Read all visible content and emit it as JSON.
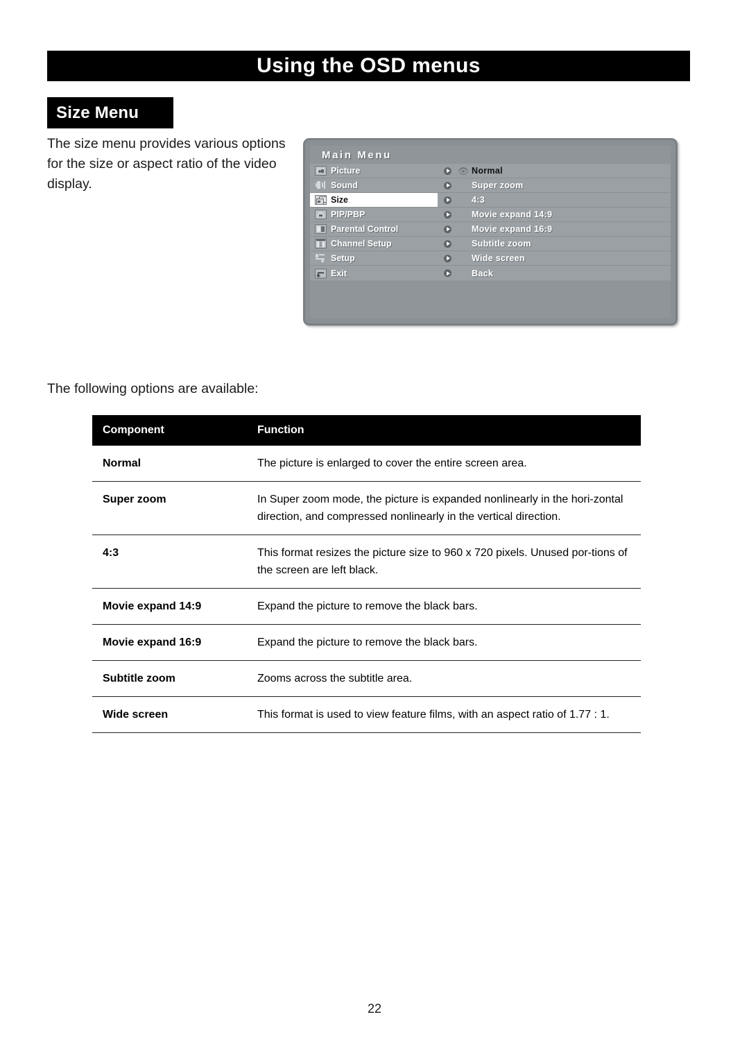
{
  "page": {
    "banner_title": "Using the OSD menus",
    "section_label": "Size Menu",
    "intro": "The size menu provides various options for the size or aspect ratio of the video display.",
    "lead_in": "The following options are available:",
    "page_number": "22"
  },
  "osd": {
    "title": "Main Menu",
    "menu_items": [
      {
        "label": "Picture",
        "icon": "picture-icon",
        "selected": false
      },
      {
        "label": "Sound",
        "icon": "speaker-icon",
        "selected": false
      },
      {
        "label": "Size",
        "icon": "size-icon",
        "selected": true
      },
      {
        "label": "PIP/PBP",
        "icon": "pip-icon",
        "selected": false
      },
      {
        "label": "Parental  Control",
        "icon": "parental-control-icon",
        "selected": false
      },
      {
        "label": "Channel  Setup",
        "icon": "channel-setup-icon",
        "selected": false
      },
      {
        "label": "Setup",
        "icon": "setup-sliders-icon",
        "selected": false
      },
      {
        "label": "Exit",
        "icon": "exit-arrow-icon",
        "selected": false
      }
    ],
    "options": [
      {
        "label": "Normal",
        "current": true,
        "marker": "eye-icon"
      },
      {
        "label": "Super  zoom",
        "current": false,
        "marker": ""
      },
      {
        "label": "4:3",
        "current": false,
        "marker": ""
      },
      {
        "label": "Movie  expand  14:9",
        "current": false,
        "marker": ""
      },
      {
        "label": "Movie  expand  16:9",
        "current": false,
        "marker": ""
      },
      {
        "label": "Subtitle  zoom",
        "current": false,
        "marker": ""
      },
      {
        "label": "Wide  screen",
        "current": false,
        "marker": ""
      },
      {
        "label": "Back",
        "current": false,
        "marker": ""
      }
    ]
  },
  "table": {
    "headers": [
      "Component",
      "Function"
    ],
    "rows": [
      {
        "component": "Normal",
        "function": "The picture is enlarged to cover the entire screen area."
      },
      {
        "component": "Super zoom",
        "function": "In Super zoom mode, the picture is expanded nonlinearly in the hori-zontal direction, and compressed nonlinearly in the vertical direction."
      },
      {
        "component": "4:3",
        "function": "This format resizes the picture size to 960 x 720 pixels. Unused por-tions of the screen are left black."
      },
      {
        "component": "Movie expand 14:9",
        "function": "Expand the picture to remove the black bars."
      },
      {
        "component": "Movie expand 16:9",
        "function": "Expand the picture to remove the black bars."
      },
      {
        "component": "Subtitle zoom",
        "function": "Zooms across the subtitle area."
      },
      {
        "component": "Wide screen",
        "function": "This format is used to view feature films, with an aspect ratio of 1.77 : 1."
      }
    ]
  }
}
